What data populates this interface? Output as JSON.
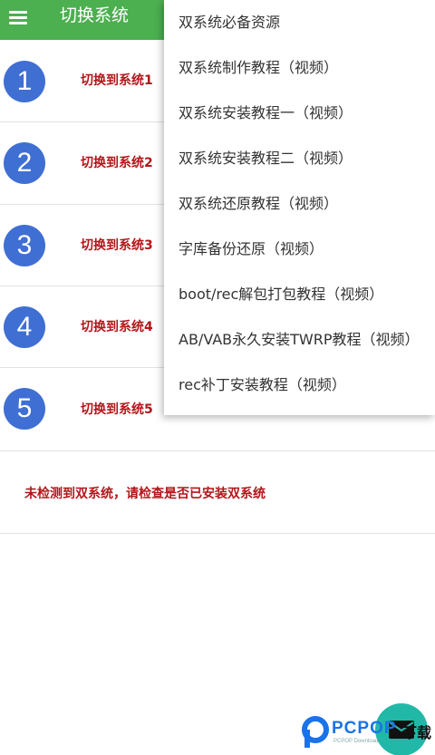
{
  "toolbar": {
    "title": "切换系统",
    "menu_icon": "hamburger-menu-icon",
    "color": "#4caf50"
  },
  "systems": [
    {
      "number": "1",
      "label": "切换到系统1"
    },
    {
      "number": "2",
      "label": "切换到系统2"
    },
    {
      "number": "3",
      "label": "切换到系统3"
    },
    {
      "number": "4",
      "label": "切换到系统4"
    },
    {
      "number": "5",
      "label": "切换到系统5"
    }
  ],
  "status_message": "未检测到双系统，请检查是否已安装双系统",
  "menu": {
    "items": [
      "双系统必备资源",
      "双系统制作教程（视频）",
      "双系统安装教程一（视频）",
      "双系统安装教程二（视频）",
      "双系统还原教程（视频）",
      "字库备份还原（视频）",
      "boot/rec解包打包教程（视频）",
      "AB/VAB永久安装TWRP教程（视频）",
      "rec补丁安装教程（视频）"
    ]
  },
  "fab": {
    "icon": "mail-icon"
  },
  "watermark": {
    "text": "PCPOP",
    "suffix": "下载",
    "subtext": "PCPOP Download"
  },
  "colors": {
    "accent": "#4caf50",
    "circle": "#3f6fd3",
    "label": "#b2161a",
    "fab": "#22b8a8"
  }
}
